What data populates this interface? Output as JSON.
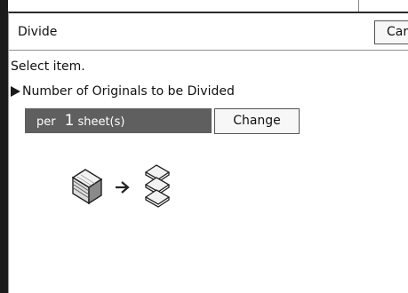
{
  "dialog": {
    "title": "Divide",
    "cancel_label": "Car"
  },
  "content": {
    "instruction": "Select item.",
    "section_label": "Number of Originals to be Divided",
    "value_prefix": "per",
    "value_number": "1",
    "value_unit": "sheet(s)",
    "change_label": "Change"
  },
  "icons": {
    "section_marker": "triangle-right-icon",
    "source": "stacked-originals-icon",
    "direction": "arrow-right-icon",
    "result": "divided-sets-icon"
  }
}
